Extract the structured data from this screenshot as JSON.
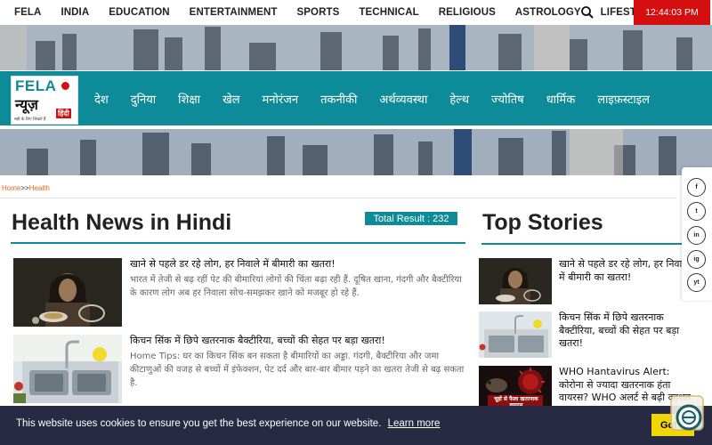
{
  "top_nav": [
    "FELA",
    "INDIA",
    "EDUCATION",
    "ENTERTAINMENT",
    "SPORTS",
    "TECHNICAL",
    "RELIGIOUS",
    "ASTROLOGY",
    "LIFESTYLE"
  ],
  "clock": "12:44:03 PM",
  "logo": {
    "brand": "FELA",
    "news": "न्यूज़",
    "hindi": "हिंदी",
    "tagline": "सही के लिए लिखते हैं"
  },
  "main_nav": [
    "देश",
    "दुनिया",
    "शिक्षा",
    "खेल",
    "मनोरंजन",
    "तकनीकी",
    "अर्थव्यवस्था",
    "हेल्थ",
    "ज्योतिष",
    "धार्मिक",
    "लाइफ़स्टाइल"
  ],
  "breadcrumb": {
    "home": "Home",
    "separator": ">>",
    "current": "Health"
  },
  "section_title": "Health News in Hindi",
  "total_result": "Total Result : 232",
  "articles": [
    {
      "title": "खाने से पहले डर रहे लोग, हर निवाले में बीमारी का खतरा!",
      "description": "भारत में तेजी से बढ़ रहीं पेट की बीमारियां लोगों की चिंता बढ़ा रही हैं. दूषित खाना, गंदगी और बैक्टीरिया के कारण लोग अब हर निवाला सोच-समझकर खाने को मजबूर हो रहे हैं."
    },
    {
      "title": "किचन सिंक में छिपे खतरनाक बैक्टीरिया, बच्चों की सेहत पर बड़ा खतरा!",
      "description": "Home Tips: घर का किचन सिंक बन सकता है बीमारियों का अड्डा. गंदगी, बैक्टीरिया और जमा कीटाणुओं की वजह से बच्चों में इंफेक्शन, पेट दर्द और बार-बार बीमार पड़ने का खतरा तेजी से बढ़ सकता है."
    }
  ],
  "top_stories_title": "Top Stories",
  "top_stories": [
    {
      "title": "खाने से पहले डर रहे लोग, हर निवाले में बीमारी का खतरा!"
    },
    {
      "title": "किचन सिंक में छिपे खतरनाक बैक्टीरिया, बच्चों की सेहत पर बड़ा खतरा!"
    },
    {
      "title": "WHO Hantavirus Alert: कोरोना से ज्यादा खतरनाक हंता वायरस? WHO अलर्ट से बढ़ी दहशत",
      "thumb_text": "चूहों से फैला खतरनाक वायरस"
    }
  ],
  "social": [
    "f",
    "t",
    "in",
    "ig",
    "yt"
  ],
  "cookie": {
    "message": "This website uses cookies to ensure you get the best experience on our website.",
    "learn_more": "Learn more",
    "button": "Got it!"
  },
  "colors": {
    "teal": "#0e8b98",
    "red": "#d50f0f",
    "orange": "#e0651a",
    "cookie_bg": "#282a43",
    "cookie_btn": "#f1d600"
  }
}
